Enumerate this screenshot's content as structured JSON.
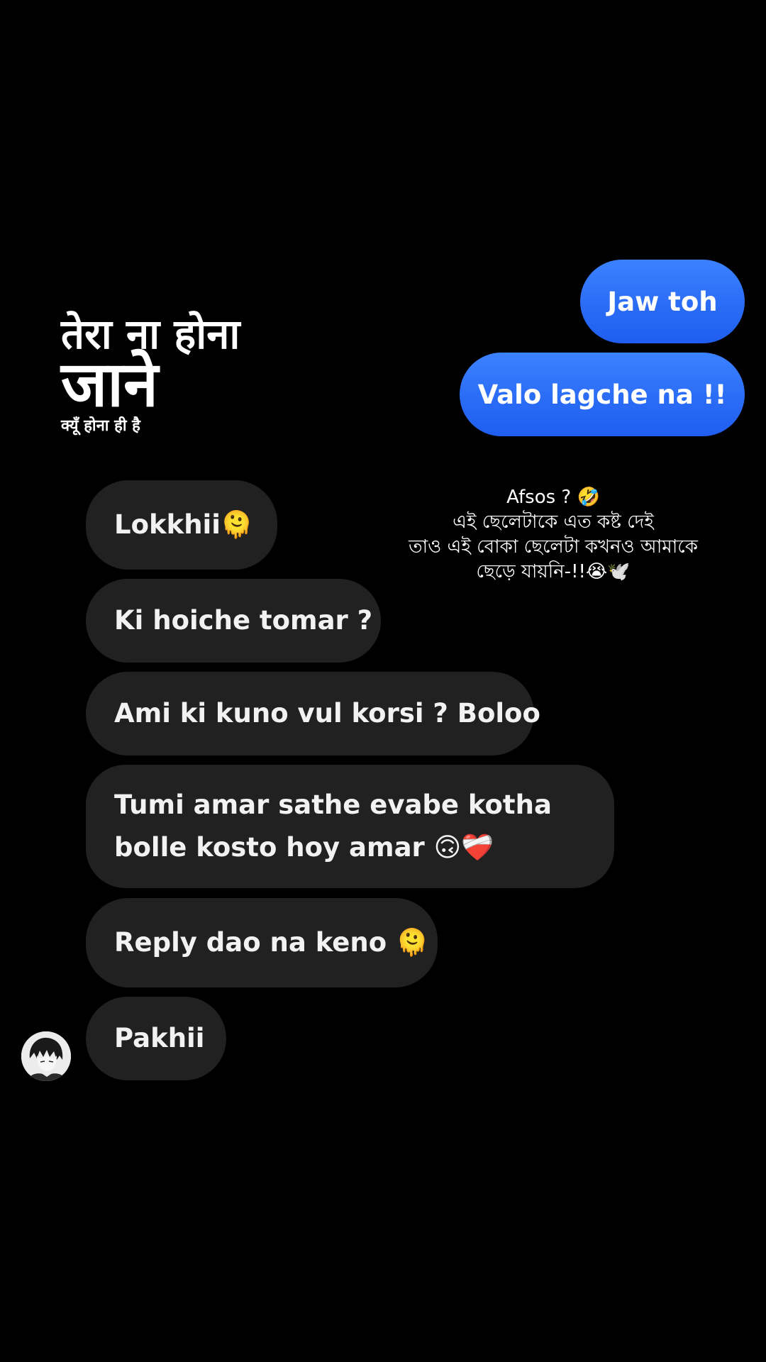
{
  "sent_messages": [
    {
      "text": "Jaw toh"
    },
    {
      "text": "Valo lagche na !!"
    }
  ],
  "sticker": {
    "line1": "तेरा ना होना",
    "line2": "जाने",
    "line3": "क्यूँ होना ही है"
  },
  "caption": {
    "line1": "Afsos ? 🤣",
    "line2": "এই ছেলেটাকে এত কষ্ট দেই",
    "line3": "তাও এই বোকা ছেলেটা কখনও আমাকে",
    "line4": "ছেড়ে যায়নি-!!😭🕊️"
  },
  "received_messages": [
    {
      "text": "Lokkhii🫠"
    },
    {
      "text": "Ki hoiche tomar ?"
    },
    {
      "text": "Ami ki kuno vul korsi ? Boloo"
    },
    {
      "text": "Tumi amar sathe evabe kotha bolle kosto hoy amar 🙃❤️‍🩹"
    },
    {
      "text": "Reply dao na keno 🫠"
    },
    {
      "text": "Pakhii"
    }
  ],
  "avatar": {
    "icon": "profile-avatar"
  },
  "colors": {
    "background": "#000000",
    "sent_bubble": "#2b6cf6",
    "received_bubble": "#212121",
    "text": "#ffffff"
  }
}
